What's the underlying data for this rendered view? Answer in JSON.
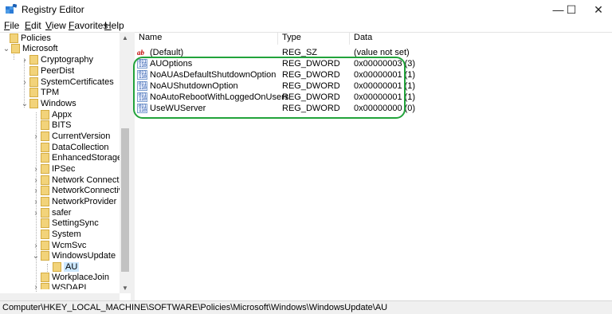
{
  "window": {
    "title": "Registry Editor",
    "minimize": "—",
    "maximize": "☐",
    "close": "✕"
  },
  "menu": [
    {
      "first": "F",
      "rest": "ile"
    },
    {
      "first": "E",
      "rest": "dit"
    },
    {
      "first": "V",
      "rest": "iew"
    },
    {
      "first": "F",
      "rest": "avorites"
    },
    {
      "first": "H",
      "rest": "elp"
    }
  ],
  "tree": [
    {
      "label": "Policies",
      "expanded": true
    },
    {
      "label": "Microsoft",
      "expanded": true
    },
    {
      "label": "Cryptography",
      "expanded": false
    },
    {
      "label": "PeerDist"
    },
    {
      "label": "SystemCertificates",
      "expanded": false
    },
    {
      "label": "TPM"
    },
    {
      "label": "Windows",
      "expanded": true
    },
    {
      "label": "Appx"
    },
    {
      "label": "BITS"
    },
    {
      "label": "CurrentVersion",
      "expanded": false
    },
    {
      "label": "DataCollection"
    },
    {
      "label": "EnhancedStorageDev"
    },
    {
      "label": "IPSec",
      "expanded": false
    },
    {
      "label": "Network Connection",
      "expanded": false
    },
    {
      "label": "NetworkConnectivity",
      "expanded": false
    },
    {
      "label": "NetworkProvider",
      "expanded": false
    },
    {
      "label": "safer",
      "expanded": false
    },
    {
      "label": "SettingSync"
    },
    {
      "label": "System"
    },
    {
      "label": "WcmSvc",
      "expanded": false
    },
    {
      "label": "WindowsUpdate",
      "expanded": true
    },
    {
      "label": "AU",
      "selected": true
    },
    {
      "label": "WorkplaceJoin"
    },
    {
      "label": "WSDAPI",
      "expanded": false
    }
  ],
  "columns": {
    "name": "Name",
    "type": "Type",
    "data": "Data"
  },
  "values": [
    {
      "name": "(Default)",
      "type": "REG_SZ",
      "data": "(value not set)",
      "icon": "string-value-icon"
    },
    {
      "name": "AUOptions",
      "type": "REG_DWORD",
      "data": "0x00000003 (3)",
      "icon": "dword-value-icon"
    },
    {
      "name": "NoAUAsDefaultShutdownOption",
      "type": "REG_DWORD",
      "data": "0x00000001 (1)",
      "icon": "dword-value-icon"
    },
    {
      "name": "NoAUShutdownOption",
      "type": "REG_DWORD",
      "data": "0x00000001 (1)",
      "icon": "dword-value-icon"
    },
    {
      "name": "NoAutoRebootWithLoggedOnUsers",
      "type": "REG_DWORD",
      "data": "0x00000001 (1)",
      "icon": "dword-value-icon"
    },
    {
      "name": "UseWUServer",
      "type": "REG_DWORD",
      "data": "0x00000000 (0)",
      "icon": "dword-value-icon"
    }
  ],
  "status": {
    "path": "Computer\\HKEY_LOCAL_MACHINE\\SOFTWARE\\Policies\\Microsoft\\Windows\\WindowsUpdate\\AU"
  },
  "colors": {
    "highlight": "#22a33b",
    "selection": "#cce8ff",
    "folder": "#f2d37a"
  }
}
